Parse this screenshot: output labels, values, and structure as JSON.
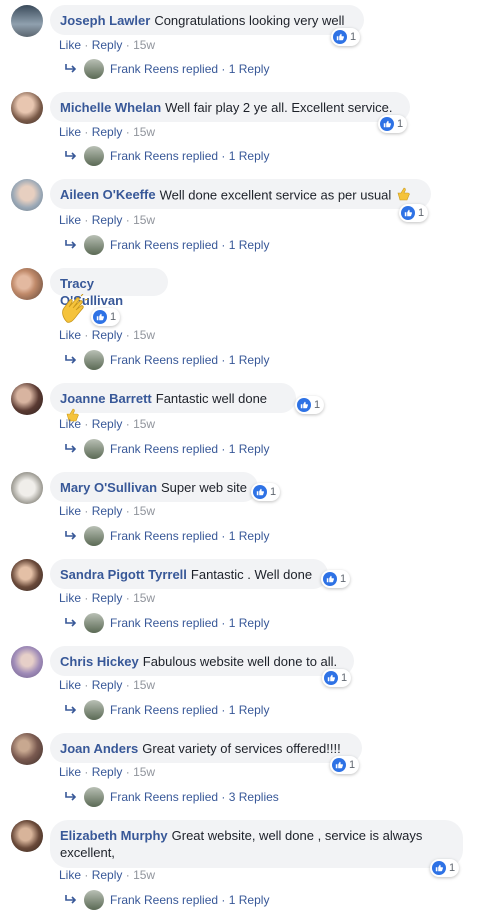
{
  "comments": [
    {
      "author": "Joseph Lawler",
      "text": "Congratulations looking very well",
      "likes": "1",
      "like_label": "Like",
      "reply_label": "Reply",
      "time": "15w",
      "replied_by": "Frank Reens replied",
      "replies": "1 Reply",
      "avatar_color": "#6d7a85"
    },
    {
      "author": "Michelle Whelan",
      "text": "Well fair play 2 ye all. Excellent service.",
      "likes": "1",
      "like_label": "Like",
      "reply_label": "Reply",
      "time": "15w",
      "replied_by": "Frank Reens replied",
      "replies": "1 Reply",
      "avatar_color": "#9c7a6a"
    },
    {
      "author": "Aileen O'Keeffe",
      "text": "Well done excellent service as per usual",
      "likes": "1",
      "like_label": "Like",
      "reply_label": "Reply",
      "time": "15w",
      "replied_by": "Frank Reens replied",
      "replies": "1 Reply",
      "avatar_color": "#8da0b0"
    },
    {
      "author": "Tracy O'Sullivan",
      "text": "",
      "likes": "1",
      "like_label": "Like",
      "reply_label": "Reply",
      "time": "15w",
      "replied_by": "Frank Reens replied",
      "replies": "1 Reply",
      "avatar_color": "#7a6a62"
    },
    {
      "author": "Joanne Barrett",
      "text": "Fantastic well done",
      "likes": "1",
      "like_label": "Like",
      "reply_label": "Reply",
      "time": "15w",
      "replied_by": "Frank Reens replied",
      "replies": "1 Reply",
      "avatar_color": "#4a3a3a"
    },
    {
      "author": "Mary O'Sullivan",
      "text": "Super web site",
      "likes": "1",
      "like_label": "Like",
      "reply_label": "Reply",
      "time": "15w",
      "replied_by": "Frank Reens replied",
      "replies": "1 Reply",
      "avatar_color": "#a8a8a0"
    },
    {
      "author": "Sandra Pigott Tyrrell",
      "text": "Fantastic . Well done",
      "likes": "1",
      "like_label": "Like",
      "reply_label": "Reply",
      "time": "15w",
      "replied_by": "Frank Reens replied",
      "replies": "1 Reply",
      "avatar_color": "#5a4638"
    },
    {
      "author": "Chris Hickey",
      "text": "Fabulous website well done to all.",
      "likes": "1",
      "like_label": "Like",
      "reply_label": "Reply",
      "time": "15w",
      "replied_by": "Frank Reens replied",
      "replies": "1 Reply",
      "avatar_color": "#8a7aa0"
    },
    {
      "author": "Joan Anders",
      "text": "Great variety of services offered!!!!",
      "likes": "1",
      "like_label": "Like",
      "reply_label": "Reply",
      "time": "15w",
      "replied_by": "Frank Reens replied",
      "replies": "3 Replies",
      "avatar_color": "#7a5a50"
    },
    {
      "author": "Elizabeth Murphy",
      "text": "Great website, well done , service is always excellent,",
      "likes": "1",
      "like_label": "Like",
      "reply_label": "Reply",
      "time": "15w",
      "replied_by": "Frank Reens replied",
      "replies": "1 Reply",
      "avatar_color": "#6a5040"
    }
  ],
  "separator": "·",
  "colors": {
    "link": "#385898",
    "bubble": "#f2f3f5",
    "like_blue": "#2e72e5",
    "muted": "#90949c"
  }
}
